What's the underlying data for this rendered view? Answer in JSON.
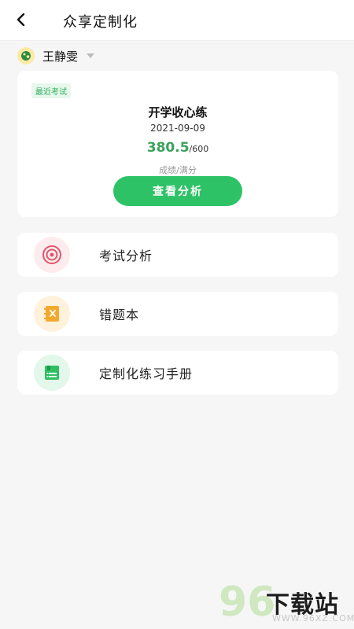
{
  "header": {
    "title": "众享定制化",
    "back_icon": "chevron-left-icon"
  },
  "student": {
    "name": "王静雯",
    "avatar_icon": "avatar-icon",
    "dropdown_icon": "caret-down-icon"
  },
  "recent_exam": {
    "tag": "最近考试",
    "title": "开学收心练",
    "date": "2021-09-09",
    "score": "380.5",
    "full_score": "/600",
    "caption": "成绩/满分",
    "button_label": "查看分析"
  },
  "menu": [
    {
      "label": "考试分析",
      "icon": "target-icon",
      "color": "#e0566b"
    },
    {
      "label": "错题本",
      "icon": "notebook-icon",
      "color": "#f3a82e"
    },
    {
      "label": "定制化练习手册",
      "icon": "book-icon",
      "color": "#2fbf62"
    }
  ],
  "watermark": {
    "number": "96",
    "text": "下载站",
    "url": "WWW.96XZ.COM"
  },
  "colors": {
    "accent": "#2ec266",
    "score": "#3aa25a"
  }
}
